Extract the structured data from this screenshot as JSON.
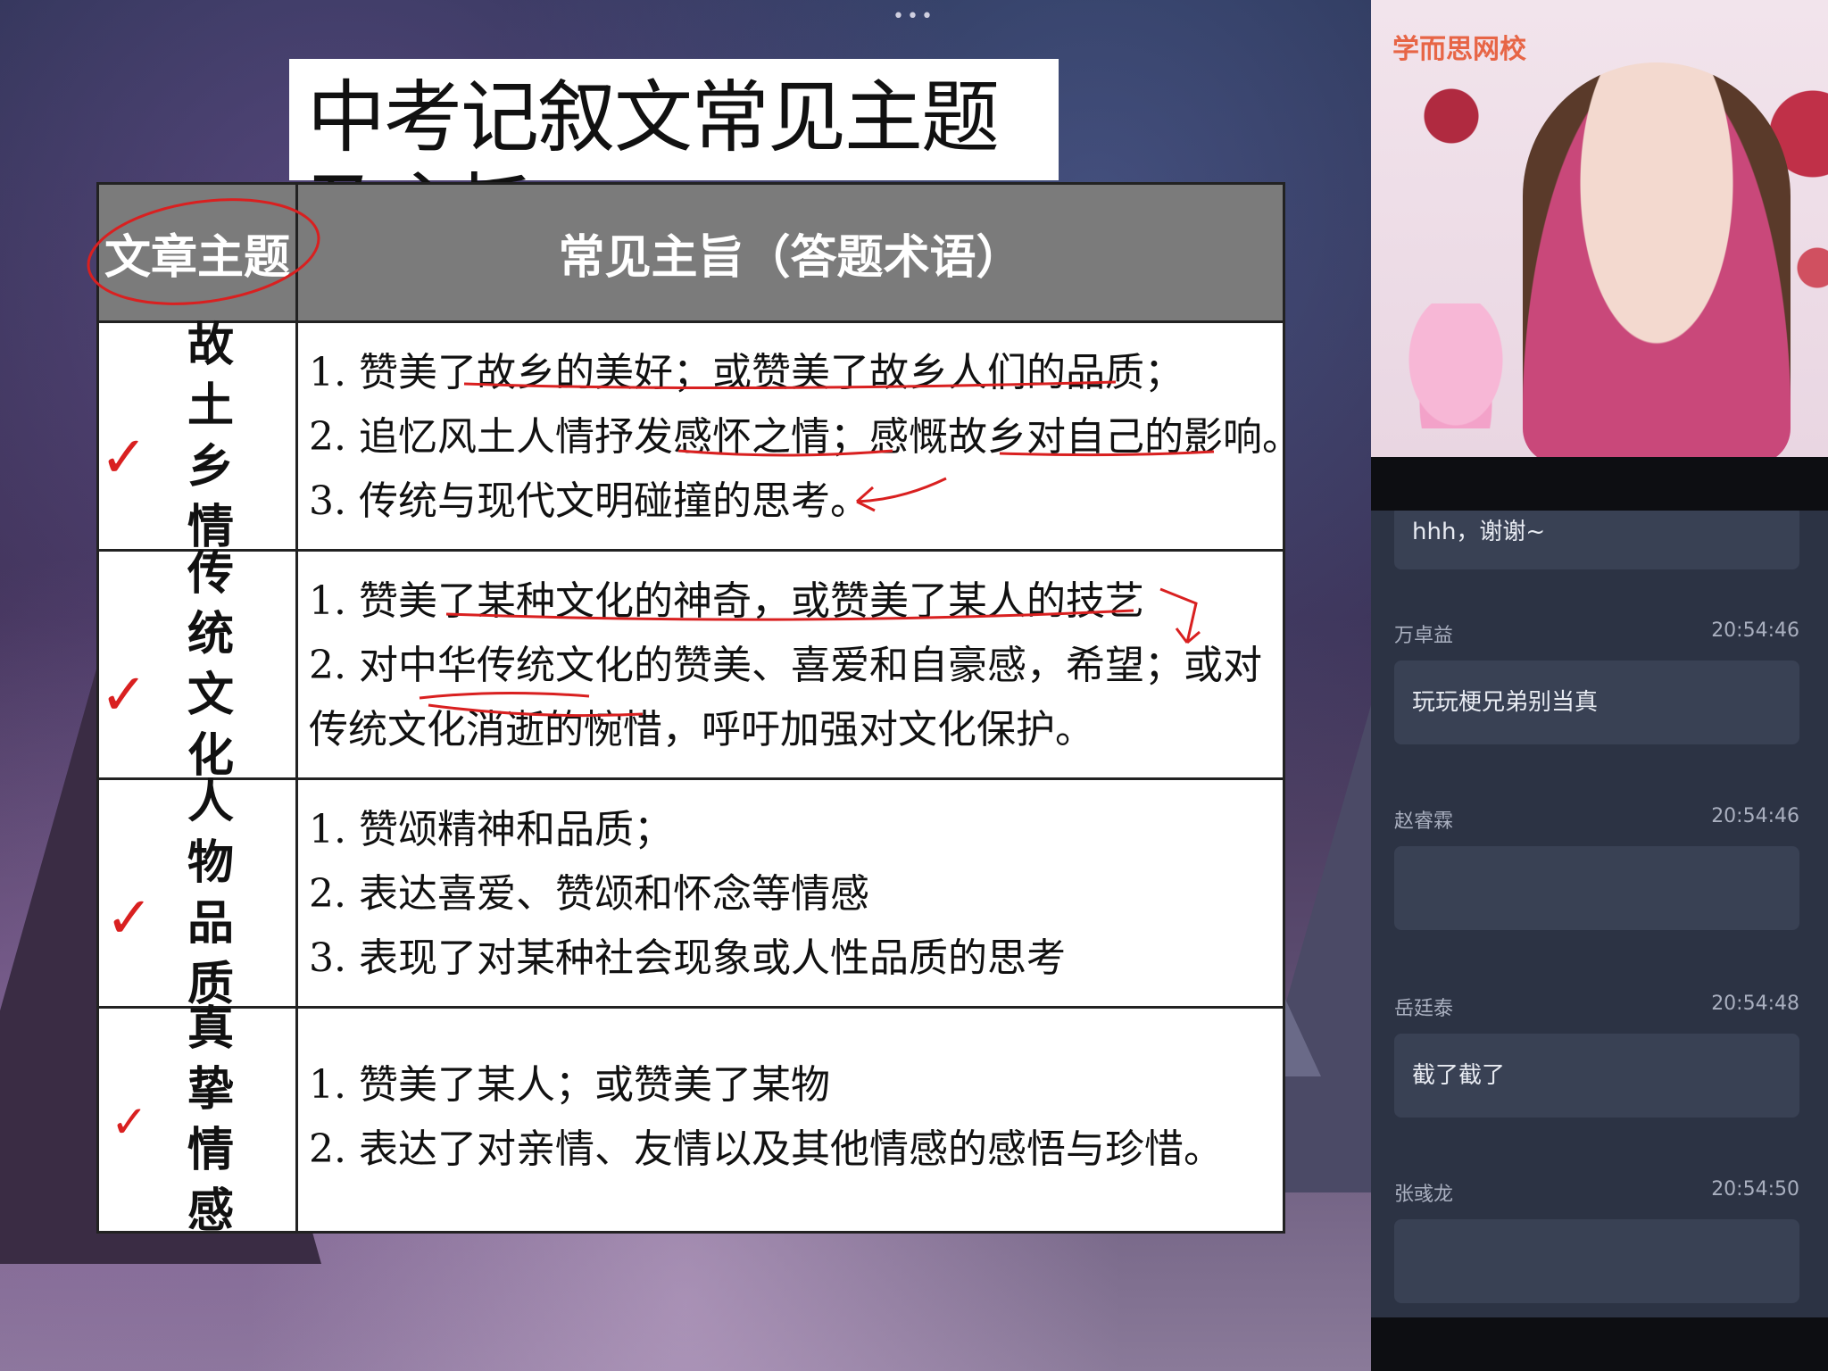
{
  "slide": {
    "top_dots": "•••",
    "title": "中考记叙文常见主题及主旨",
    "table": {
      "header_left": "文章主题",
      "header_right": "常见主旨（答题术语）",
      "rows": [
        {
          "theme": "故土乡情",
          "lines": [
            "1. 赞美了故乡的美好；或赞美了故乡人们的品质；",
            "2. 追忆风土人情抒发感怀之情；感慨故乡对自己的影响。",
            "3. 传统与现代文明碰撞的思考。"
          ]
        },
        {
          "theme": "传统文化",
          "lines": [
            "1. 赞美了某种文化的神奇，或赞美了某人的技艺",
            "2. 对中华传统文化的赞美、喜爱和自豪感，希望；或对",
            "传统文化消逝的惋惜，呼吁加强对文化保护。"
          ]
        },
        {
          "theme": "人物品质",
          "lines": [
            "1. 赞颂精神和品质；",
            "2. 表达喜爱、赞颂和怀念等情感",
            "3. 表现了对某种社会现象或人性品质的思考"
          ]
        },
        {
          "theme": "真挚情感",
          "lines": [
            "1. 赞美了某人；或赞美了某物",
            "2. 表达了对亲情、友情以及其他情感的感悟与珍惜。"
          ]
        }
      ]
    },
    "check_mark": "✓"
  },
  "video": {
    "logo_text": "学而思网校"
  },
  "chat": {
    "first_message": "hhh，谢谢~",
    "messages": [
      {
        "name": "万卓益",
        "time": "20:54:46",
        "text": "玩玩梗兄弟别当真"
      },
      {
        "name": "赵睿霖",
        "time": "20:54:46",
        "text": ""
      },
      {
        "name": "岳廷泰",
        "time": "20:54:48",
        "text": "截了截了"
      },
      {
        "name": "张彧龙",
        "time": "20:54:50",
        "text": ""
      }
    ]
  },
  "colors": {
    "header_gray": "#7b7b7b",
    "annotation_red": "#d92020",
    "chat_bg": "#2c3344",
    "chat_bubble": "#394154"
  }
}
